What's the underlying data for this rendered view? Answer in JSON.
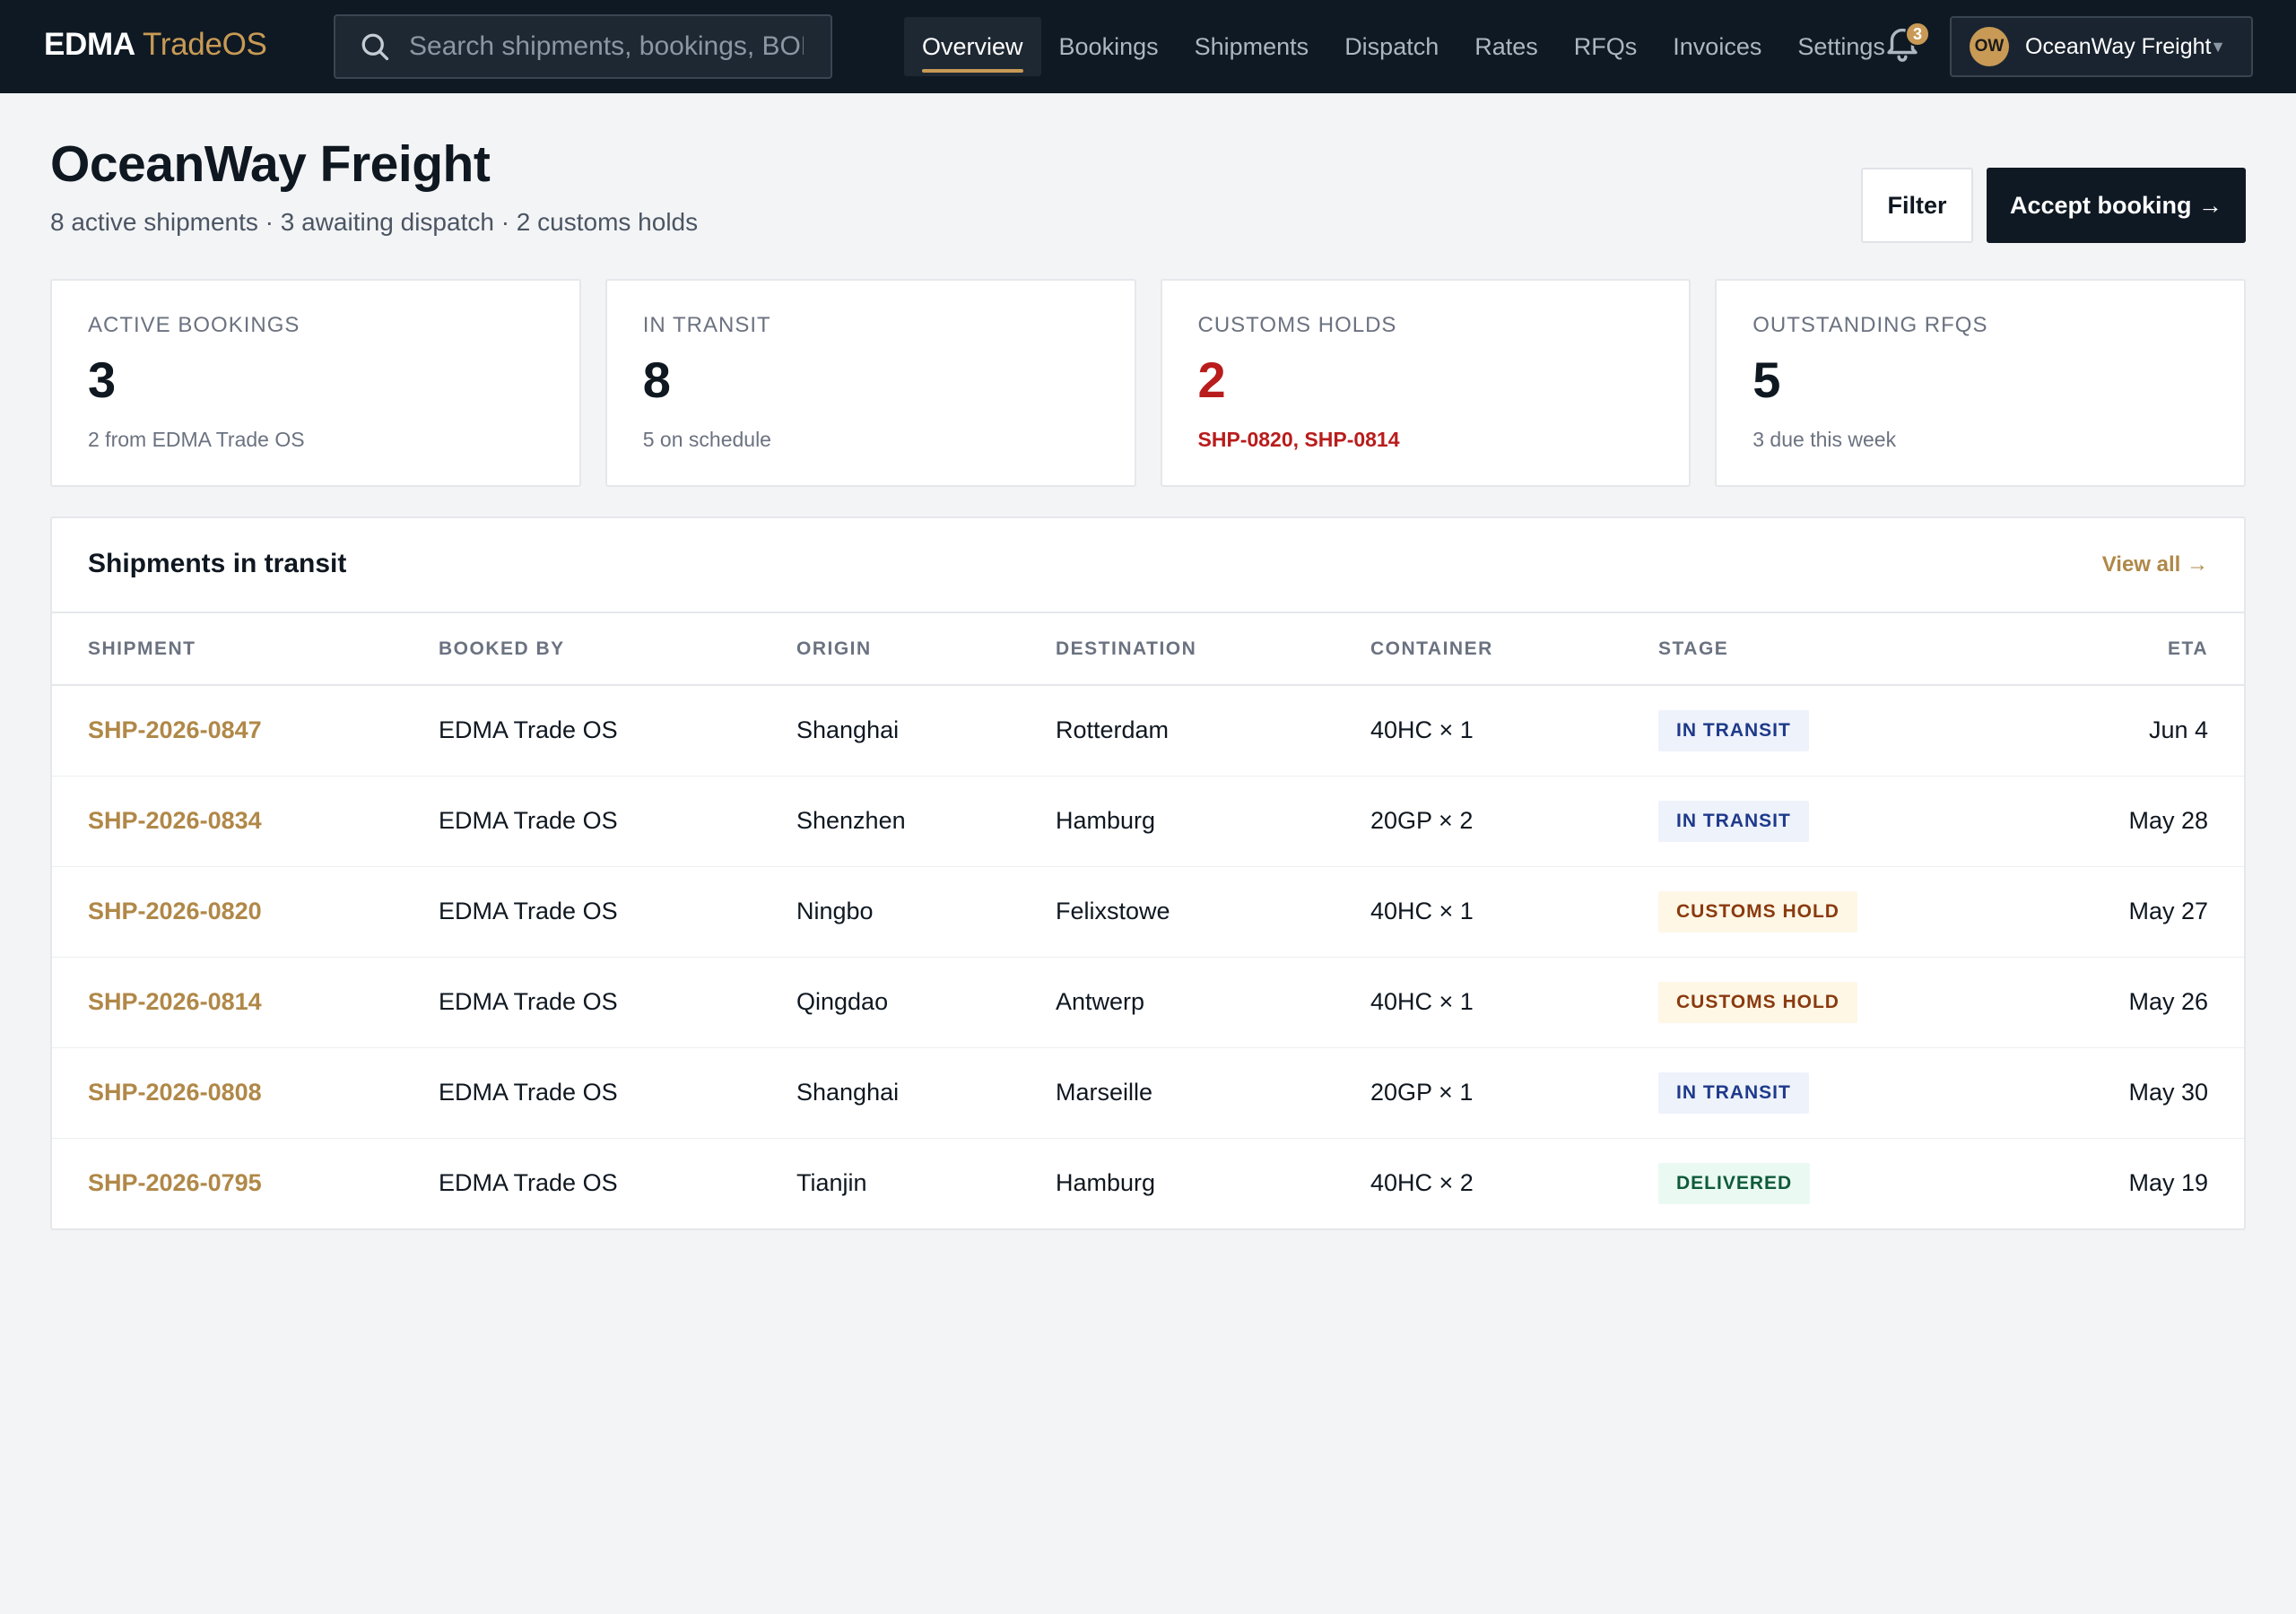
{
  "brand": {
    "name": "EDMA",
    "product": "TradeOS"
  },
  "search": {
    "placeholder": "Search shipments, bookings, BOLs..."
  },
  "nav": {
    "items": [
      {
        "label": "Overview",
        "active": true
      },
      {
        "label": "Bookings"
      },
      {
        "label": "Shipments"
      },
      {
        "label": "Dispatch"
      },
      {
        "label": "Rates"
      },
      {
        "label": "RFQs"
      },
      {
        "label": "Invoices"
      },
      {
        "label": "Settings"
      }
    ],
    "notifications": {
      "count": "3",
      "icon": "bell-icon"
    }
  },
  "account": {
    "initials": "OW",
    "name": "OceanWay Freight",
    "caret": "▼"
  },
  "header": {
    "title": "OceanWay Freight",
    "subtitle": "8 active shipments · 3 awaiting dispatch · 2 customs holds",
    "filter_label": "Filter",
    "accept_label": "Accept booking →"
  },
  "stats": [
    {
      "label": "ACTIVE BOOKINGS",
      "value": "3",
      "note": "2 from EDMA Trade OS"
    },
    {
      "label": "IN TRANSIT",
      "value": "8",
      "note": "5 on schedule"
    },
    {
      "label": "CUSTOMS HOLDS",
      "value": "2",
      "note": "SHP-0820, SHP-0814",
      "alert": true
    },
    {
      "label": "OUTSTANDING RFQS",
      "value": "5",
      "note": "3 due this week"
    }
  ],
  "shipments_panel": {
    "title": "Shipments in transit",
    "view_all": "View all →",
    "columns": [
      "SHIPMENT",
      "BOOKED BY",
      "ORIGIN",
      "DESTINATION",
      "CONTAINER",
      "STAGE",
      "ETA"
    ],
    "rows": [
      {
        "id": "SHP-2026-0847",
        "booked_by": "EDMA Trade OS",
        "origin": "Shanghai",
        "destination": "Rotterdam",
        "container": "40HC × 1",
        "stage": "IN TRANSIT",
        "eta": "Jun 4"
      },
      {
        "id": "SHP-2026-0834",
        "booked_by": "EDMA Trade OS",
        "origin": "Shenzhen",
        "destination": "Hamburg",
        "container": "20GP × 2",
        "stage": "IN TRANSIT",
        "eta": "May 28"
      },
      {
        "id": "SHP-2026-0820",
        "booked_by": "EDMA Trade OS",
        "origin": "Ningbo",
        "destination": "Felixstowe",
        "container": "40HC × 1",
        "stage": "CUSTOMS HOLD",
        "eta": "May 27"
      },
      {
        "id": "SHP-2026-0814",
        "booked_by": "EDMA Trade OS",
        "origin": "Qingdao",
        "destination": "Antwerp",
        "container": "40HC × 1",
        "stage": "CUSTOMS HOLD",
        "eta": "May 26"
      },
      {
        "id": "SHP-2026-0808",
        "booked_by": "EDMA Trade OS",
        "origin": "Shanghai",
        "destination": "Marseille",
        "container": "20GP × 1",
        "stage": "IN TRANSIT",
        "eta": "May 30"
      },
      {
        "id": "SHP-2026-0795",
        "booked_by": "EDMA Trade OS",
        "origin": "Tianjin",
        "destination": "Hamburg",
        "container": "40HC × 2",
        "stage": "DELIVERED",
        "eta": "May 19"
      }
    ]
  },
  "colors": {
    "topbar": "#0f1923",
    "accent": "#c89a55",
    "alert": "#b91c1c",
    "stage_transit": "#1e3a8a",
    "stage_hold": "#8a3a0f",
    "stage_delivered": "#0f5a3a"
  }
}
